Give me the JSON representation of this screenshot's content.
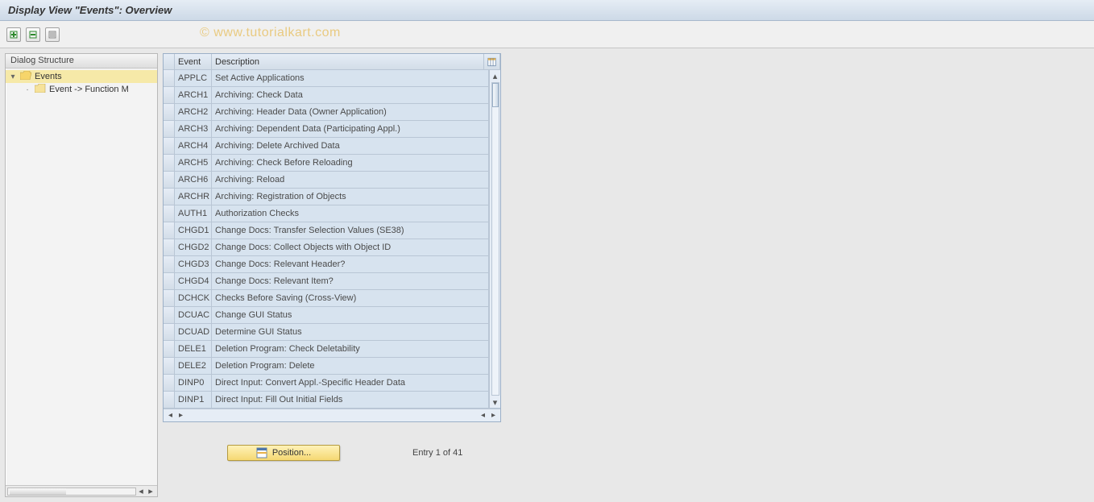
{
  "title": "Display View \"Events\": Overview",
  "watermark": "© www.tutorialkart.com",
  "dialog_structure": {
    "header": "Dialog Structure",
    "root": {
      "label": "Events"
    },
    "child": {
      "label": "Event -> Function M"
    }
  },
  "table": {
    "headers": {
      "event": "Event",
      "description": "Description"
    },
    "rows": [
      {
        "event": "APPLC",
        "desc": "Set Active Applications"
      },
      {
        "event": "ARCH1",
        "desc": "Archiving: Check Data"
      },
      {
        "event": "ARCH2",
        "desc": "Archiving: Header Data (Owner Application)"
      },
      {
        "event": "ARCH3",
        "desc": "Archiving: Dependent Data (Participating Appl.)"
      },
      {
        "event": "ARCH4",
        "desc": "Archiving: Delete Archived Data"
      },
      {
        "event": "ARCH5",
        "desc": "Archiving: Check Before Reloading"
      },
      {
        "event": "ARCH6",
        "desc": "Archiving: Reload"
      },
      {
        "event": "ARCHR",
        "desc": "Archiving: Registration of Objects"
      },
      {
        "event": "AUTH1",
        "desc": "Authorization Checks"
      },
      {
        "event": "CHGD1",
        "desc": "Change Docs: Transfer Selection Values (SE38)"
      },
      {
        "event": "CHGD2",
        "desc": "Change Docs: Collect Objects with Object ID"
      },
      {
        "event": "CHGD3",
        "desc": "Change Docs: Relevant Header?"
      },
      {
        "event": "CHGD4",
        "desc": "Change Docs: Relevant Item?"
      },
      {
        "event": "DCHCK",
        "desc": "Checks Before Saving (Cross-View)"
      },
      {
        "event": "DCUAC",
        "desc": "Change GUI Status"
      },
      {
        "event": "DCUAD",
        "desc": "Determine GUI Status"
      },
      {
        "event": "DELE1",
        "desc": "Deletion Program: Check Deletability"
      },
      {
        "event": "DELE2",
        "desc": "Deletion Program: Delete"
      },
      {
        "event": "DINP0",
        "desc": "Direct Input: Convert Appl.-Specific Header Data"
      },
      {
        "event": "DINP1",
        "desc": "Direct Input: Fill Out Initial Fields"
      }
    ]
  },
  "footer": {
    "position_label": "Position...",
    "entry_info": "Entry 1 of 41"
  }
}
